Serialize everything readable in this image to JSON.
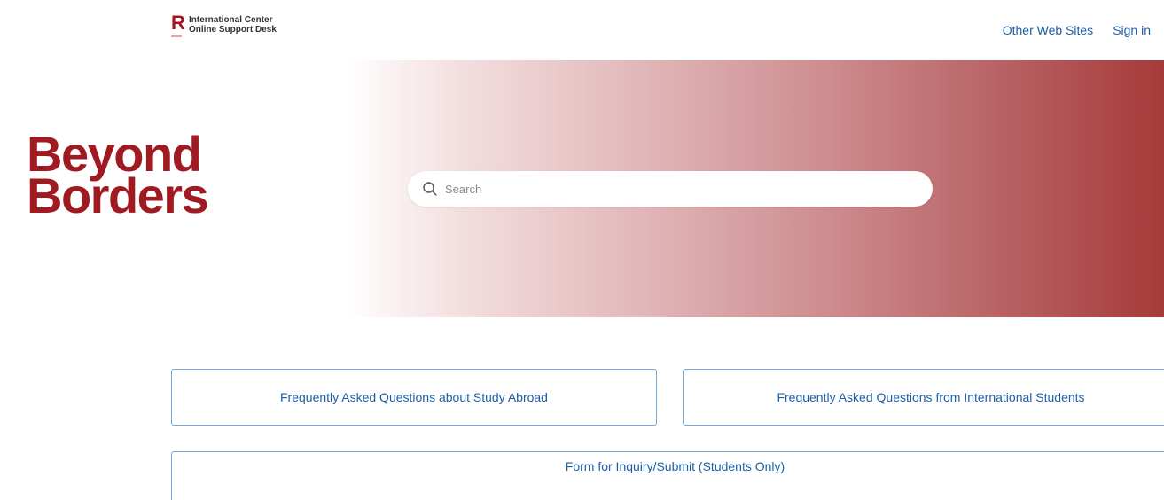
{
  "header": {
    "logo_line1": "International Center",
    "logo_line2": "Online Support Desk",
    "logo_letter": "R",
    "nav": {
      "other_sites": "Other Web Sites",
      "sign_in": "Sign in"
    }
  },
  "hero": {
    "title_line1": "Beyond",
    "title_line2": "Borders",
    "search_placeholder": "Search"
  },
  "cards": {
    "study_abroad": "Frequently Asked Questions about Study Abroad",
    "international": "Frequently Asked Questions from International Students",
    "inquiry": "Form for Inquiry/Submit (Students Only)"
  },
  "colors": {
    "brand_red": "#a01a22",
    "link_blue": "#1d5fa7",
    "card_border": "#6ea8df"
  },
  "icons": {
    "search": "search-icon"
  }
}
